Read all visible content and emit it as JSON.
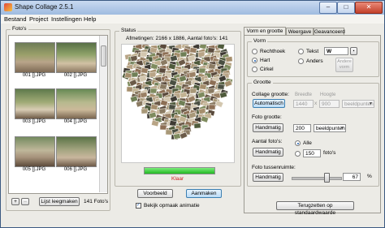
{
  "window": {
    "title": "Shape Collage 2.5.1",
    "minimize": "–",
    "maximize": "□",
    "close": "✕"
  },
  "menu": [
    "Bestand",
    "Project",
    "Instellingen",
    "Help"
  ],
  "photos_panel": {
    "label": "Foto's",
    "items": [
      {
        "caption": "001 [].JPG"
      },
      {
        "caption": "002 [].JPG"
      },
      {
        "caption": "003 [].JPG"
      },
      {
        "caption": "004 [].JPG"
      },
      {
        "caption": "005 [].JPG"
      },
      {
        "caption": "006 [].JPG"
      }
    ],
    "add_label": "+",
    "remove_label": "–",
    "clear_label": "Lijst leegmaken",
    "count_text": "141 Foto's"
  },
  "status_panel": {
    "label": "Status",
    "info": "Afmetingen: 2166 x 1886, Aantal foto's: 141",
    "progress": 1.0,
    "status_text": "Klaar",
    "preview_button": "Voorbeeld",
    "create_button": "Aanmaken",
    "animate_label": "Bekijk opmaak animatie",
    "animate_checked": true
  },
  "tabs": [
    {
      "label": "Vorm en grootte",
      "active": true
    },
    {
      "label": "Weergave",
      "active": false
    },
    {
      "label": "Geavanceerd",
      "active": false
    }
  ],
  "shape": {
    "label": "Vorm",
    "options": [
      {
        "label": "Rechthoek",
        "selected": false
      },
      {
        "label": "Hart",
        "selected": true
      },
      {
        "label": "Cirkel",
        "selected": false
      },
      {
        "label": "Tekst",
        "selected": false
      },
      {
        "label": "Anders",
        "selected": false
      }
    ],
    "text_value": "W",
    "other_button": "Andere vorm"
  },
  "size": {
    "label": "Grootte",
    "collage_label": "Collage grootte:",
    "collage_button": "Automatisch",
    "width_label": "Breedte",
    "height_label": "Hoogte",
    "width_value": "1440",
    "height_value": "900",
    "unit_value": "beeldpunten",
    "photo_label": "Foto grootte:",
    "photo_button": "Handmatig",
    "photo_value": "200",
    "photo_unit": "beeldpunten",
    "count_label": "Aantal foto's:",
    "count_button": "Handmatig",
    "count_all": "Alle",
    "count_value": "150",
    "count_unit": "foto's",
    "spacing_label": "Foto tussenruimte:",
    "spacing_button": "Handmatig",
    "spacing_value": "67",
    "spacing_unit": "%"
  },
  "reset_button": "Terugzetten op standaardwaarde",
  "colors": {
    "accent": "#3c7fb1",
    "status_text": "#cc1f1f",
    "progress": "#2bd12b"
  }
}
